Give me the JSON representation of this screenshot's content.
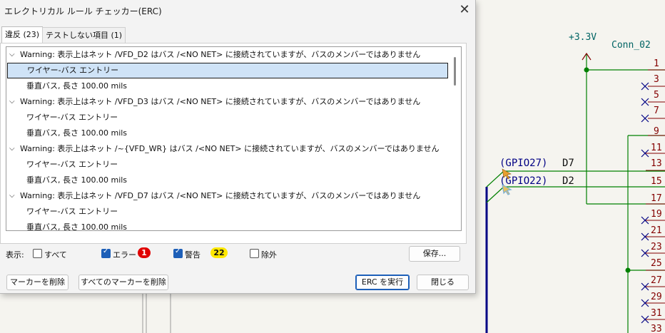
{
  "dialog": {
    "title": "エレクトリカル ルール チェッカー(ERC)",
    "close_label": "✕",
    "tabs": [
      {
        "label": "違反 (23)"
      },
      {
        "label": "テストしない項目 (1)"
      }
    ],
    "violations": [
      {
        "type": "warning",
        "text": "Warning: 表示上はネット /VFD_D2 はバス /<NO NET> に接続されていますが、バスのメンバーではありません"
      },
      {
        "type": "child",
        "text": "ワイヤー-バス エントリー",
        "selected": true
      },
      {
        "type": "child",
        "text": "垂直バス, 長さ 100.00 mils"
      },
      {
        "type": "warning",
        "text": "Warning: 表示上はネット /VFD_D3 はバス /<NO NET> に接続されていますが、バスのメンバーではありません"
      },
      {
        "type": "child",
        "text": "ワイヤー-バス エントリー"
      },
      {
        "type": "child",
        "text": "垂直バス, 長さ 100.00 mils"
      },
      {
        "type": "warning",
        "text": "Warning: 表示上はネット /~{VFD_WR} はバス /<NO NET> に接続されていますが、バスのメンバーではありません"
      },
      {
        "type": "child",
        "text": "ワイヤー-バス エントリー"
      },
      {
        "type": "child",
        "text": "垂直バス, 長さ 100.00 mils"
      },
      {
        "type": "warning",
        "text": "Warning: 表示上はネット /VFD_D7 はバス /<NO NET> に接続されていますが、バスのメンバーではありません"
      },
      {
        "type": "child",
        "text": "ワイヤー-バス エントリー"
      },
      {
        "type": "child",
        "text": "垂直バス, 長さ 100.00 mils"
      }
    ],
    "filters": {
      "label": "表示:",
      "all": {
        "label": "すべて",
        "checked": false
      },
      "errors": {
        "label": "エラー",
        "checked": true,
        "count": "1"
      },
      "warnings": {
        "label": "警告",
        "checked": true,
        "count": "22"
      },
      "exclusions": {
        "label": "除外",
        "checked": false
      }
    },
    "buttons": {
      "save": "保存...",
      "delete_marker": "マーカーを削除",
      "delete_all_markers": "すべてのマーカーを削除",
      "run_erc": "ERC を実行",
      "close": "閉じる"
    }
  },
  "schematic": {
    "power_label": "+3.3V",
    "connector_ref": "Conn_02",
    "net_labels": [
      {
        "name": "(GPIO27)",
        "signal": "D7"
      },
      {
        "name": "(GPIO22)",
        "signal": "D2"
      }
    ],
    "pin_numbers": [
      "1",
      "3",
      "5",
      "7",
      "9",
      "11",
      "13",
      "15",
      "17",
      "19",
      "21",
      "23",
      "25",
      "27",
      "29",
      "31",
      "33"
    ],
    "colors": {
      "wire": "#008000",
      "bus": "#000084",
      "pin": "#840000",
      "label": "#006464",
      "background": "#f5f4ef"
    }
  }
}
